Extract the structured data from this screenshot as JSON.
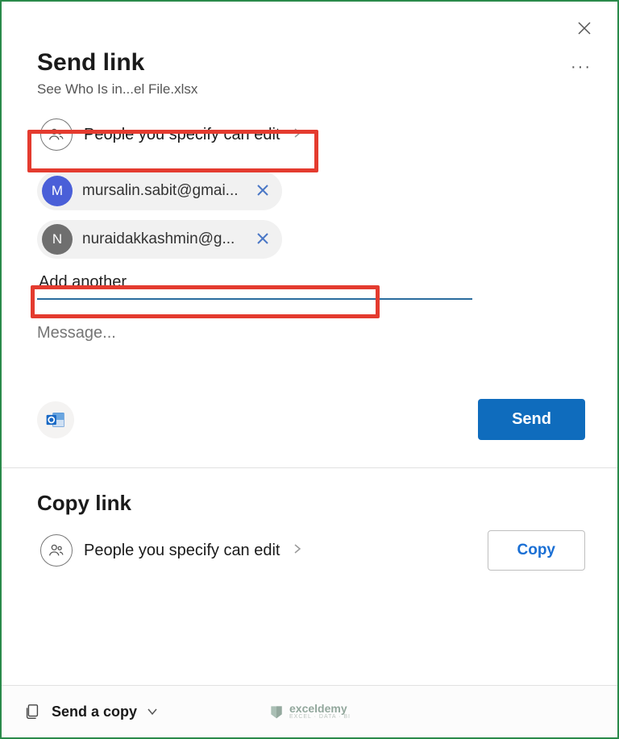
{
  "title": "Send link",
  "file_name": "See Who Is in...el File.xlsx",
  "permission_label": "People you specify can edit",
  "recipients": [
    {
      "initial": "M",
      "email": "mursalin.sabit@gmai...",
      "color": "blue"
    },
    {
      "initial": "N",
      "email": "nuraidakkashmin@g...",
      "color": "gray"
    }
  ],
  "add_input_value": "Add another",
  "message_placeholder": "Message...",
  "send_button": "Send",
  "copy_section_title": "Copy link",
  "copy_permission_label": "People you specify can edit",
  "copy_button": "Copy",
  "footer_label": "Send a copy",
  "watermark_main": "exceldemy",
  "watermark_sub": "EXCEL · DATA · BI"
}
